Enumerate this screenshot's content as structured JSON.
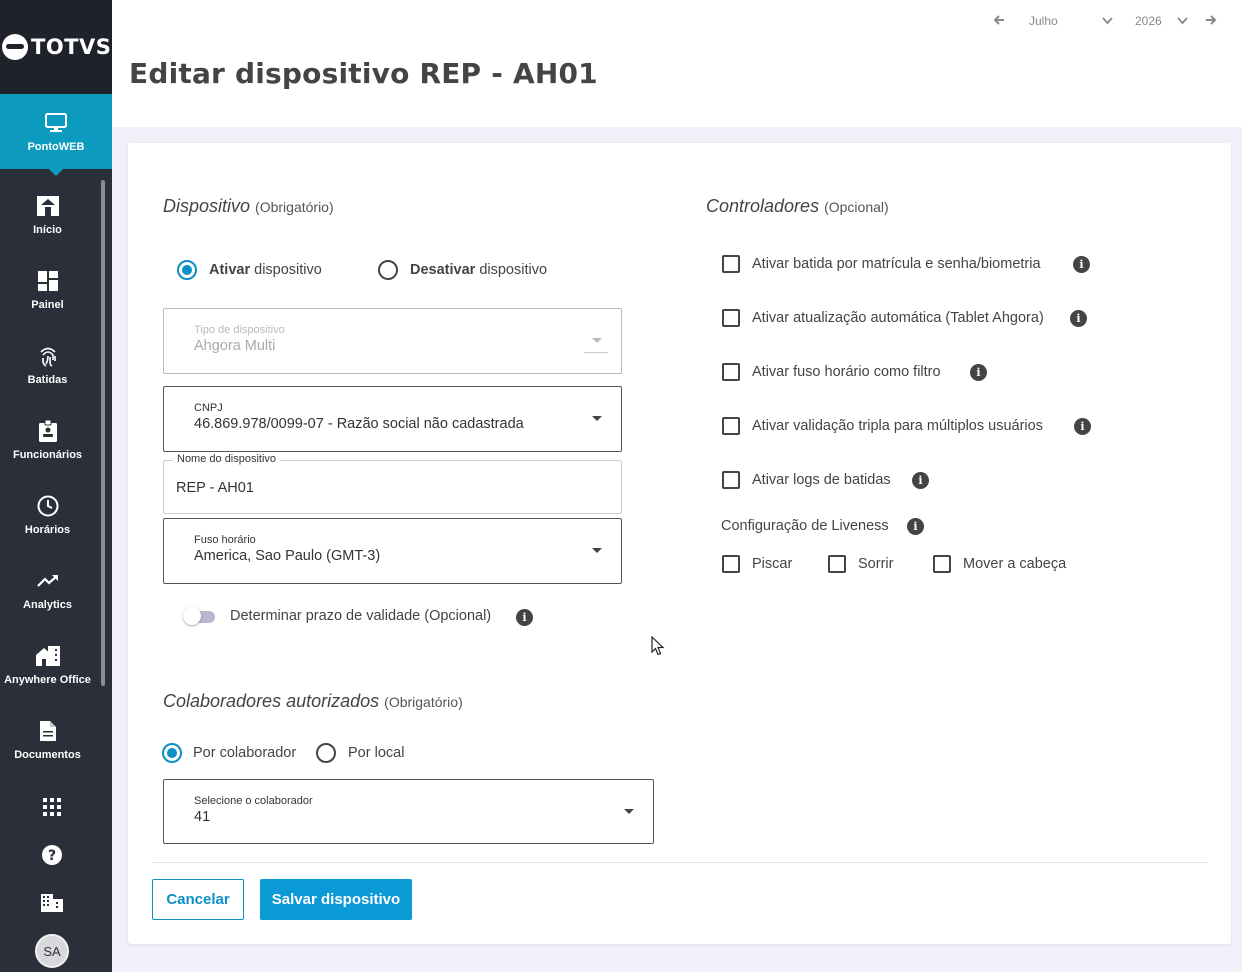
{
  "brand": {
    "logo_text": "TOTVS"
  },
  "sidebar": {
    "active": {
      "label": "PontoWEB",
      "icon": "monitor-icon"
    },
    "items": [
      {
        "label": "Início",
        "icon": "home-icon"
      },
      {
        "label": "Painel",
        "icon": "dashboard-icon"
      },
      {
        "label": "Batidas",
        "icon": "fingerprint-icon"
      },
      {
        "label": "Funcionários",
        "icon": "badge-icon"
      },
      {
        "label": "Horários",
        "icon": "clock-icon"
      },
      {
        "label": "Analytics",
        "icon": "trending-up-icon"
      },
      {
        "label": "Anywhere Office",
        "icon": "home-work-icon"
      },
      {
        "label": "Documentos",
        "icon": "document-icon"
      }
    ],
    "bottom": [
      {
        "icon": "apps-grid-icon"
      },
      {
        "icon": "help-icon"
      },
      {
        "icon": "building-icon"
      }
    ],
    "avatar_initials": "SA"
  },
  "header": {
    "title": "Editar dispositivo REP - AH01",
    "month": "Julho",
    "year": "2026"
  },
  "device": {
    "section_title": "Dispositivo",
    "section_note": "(Obrigatório)",
    "status_options": [
      {
        "bold": "Ativar",
        "rest": " dispositivo",
        "selected": true
      },
      {
        "bold": "Desativar",
        "rest": " dispositivo",
        "selected": false
      }
    ],
    "type_label": "Tipo de dispositivo",
    "type_value": "Ahgora Multi",
    "cnpj_label": "CNPJ",
    "cnpj_value": "46.869.978/0099-07 - Razão social não cadastrada",
    "name_label": "Nome do dispositivo",
    "name_value": "REP - AH01",
    "tz_label": "Fuso horário",
    "tz_value": "America, Sao Paulo (GMT-3)",
    "validity_toggle_label": "Determinar prazo de validade (Opcional)",
    "validity_enabled": false
  },
  "controllers": {
    "section_title": "Controladores",
    "section_note": "(Opcional)",
    "options": [
      {
        "label": "Ativar batida por matrícula e senha/biometria",
        "checked": false
      },
      {
        "label": "Ativar atualização automática (Tablet Ahgora)",
        "checked": false
      },
      {
        "label": "Ativar fuso horário como filtro",
        "checked": false
      },
      {
        "label": "Ativar validação tripla para múltiplos usuários",
        "checked": false
      },
      {
        "label": "Ativar logs de batidas",
        "checked": false
      }
    ],
    "liveness_title": "Configuração de Liveness",
    "liveness_options": [
      {
        "label": "Piscar",
        "checked": false
      },
      {
        "label": "Sorrir",
        "checked": false
      },
      {
        "label": "Mover a cabeça",
        "checked": false
      }
    ]
  },
  "collaborators": {
    "section_title": "Colaboradores autorizados",
    "section_note": "(Obrigatório)",
    "mode_options": [
      {
        "label": "Por colaborador",
        "selected": true
      },
      {
        "label": "Por local",
        "selected": false
      }
    ],
    "select_label": "Selecione o colaborador",
    "select_value": "41"
  },
  "actions": {
    "cancel": "Cancelar",
    "save": "Salvar dispositivo"
  },
  "colors": {
    "sidebar_bg": "#2b2f3a",
    "active_nav": "#0c9abe",
    "primary": "#0c8ec7",
    "page_bg": "#f0f0f8"
  }
}
